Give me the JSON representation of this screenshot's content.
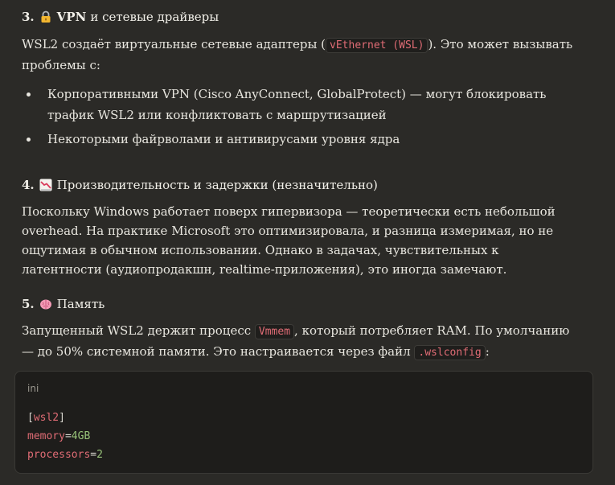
{
  "sections": {
    "s3": {
      "number": "3.",
      "icon": "lock-icon",
      "title_bold": "VPN",
      "title_rest": "и сетевые драйверы",
      "p1_before": "WSL2 создаёт виртуальные сетевые адаптеры (",
      "p1_code": "vEthernet (WSL)",
      "p1_after": "). Это может вызывать проблемы с:",
      "bullets": [
        "Корпоративными VPN (Cisco AnyConnect, GlobalProtect) — могут блокировать трафик WSL2 или конфликтовать с маршрутизацией",
        "Некоторыми файрволами и антивирусами уровня ядра"
      ]
    },
    "s4": {
      "number": "4.",
      "icon": "chart-decreasing-icon",
      "title": "Производительность и задержки (незначительно)",
      "paragraph": "Поскольку Windows работает поверх гипервизора — теоретически есть небольшой overhead. На практике Microsoft это оптимизировала, и разница измеримая, но не ощутимая в обычном использовании. Однако в задачах, чувствительных к латентности (аудиопродакшн, realtime-приложения), это иногда замечают."
    },
    "s5": {
      "number": "5.",
      "icon": "brain-icon",
      "title": "Память",
      "p_before": "Запущенный WSL2 держит процесс ",
      "p_code1": "Vmmem",
      "p_mid": ", который потребляет RAM. По умолчанию — до 50% системной памяти. Это настраивается через файл ",
      "p_code2": ".wslconfig",
      "p_after": ":"
    }
  },
  "code": {
    "lang": "ini",
    "section_open": "[",
    "section_name": "wsl2",
    "section_close": "]",
    "lines": [
      {
        "key": "memory",
        "eq": "=",
        "value": "4GB"
      },
      {
        "key": "processors",
        "eq": "=",
        "value": "2"
      }
    ]
  }
}
